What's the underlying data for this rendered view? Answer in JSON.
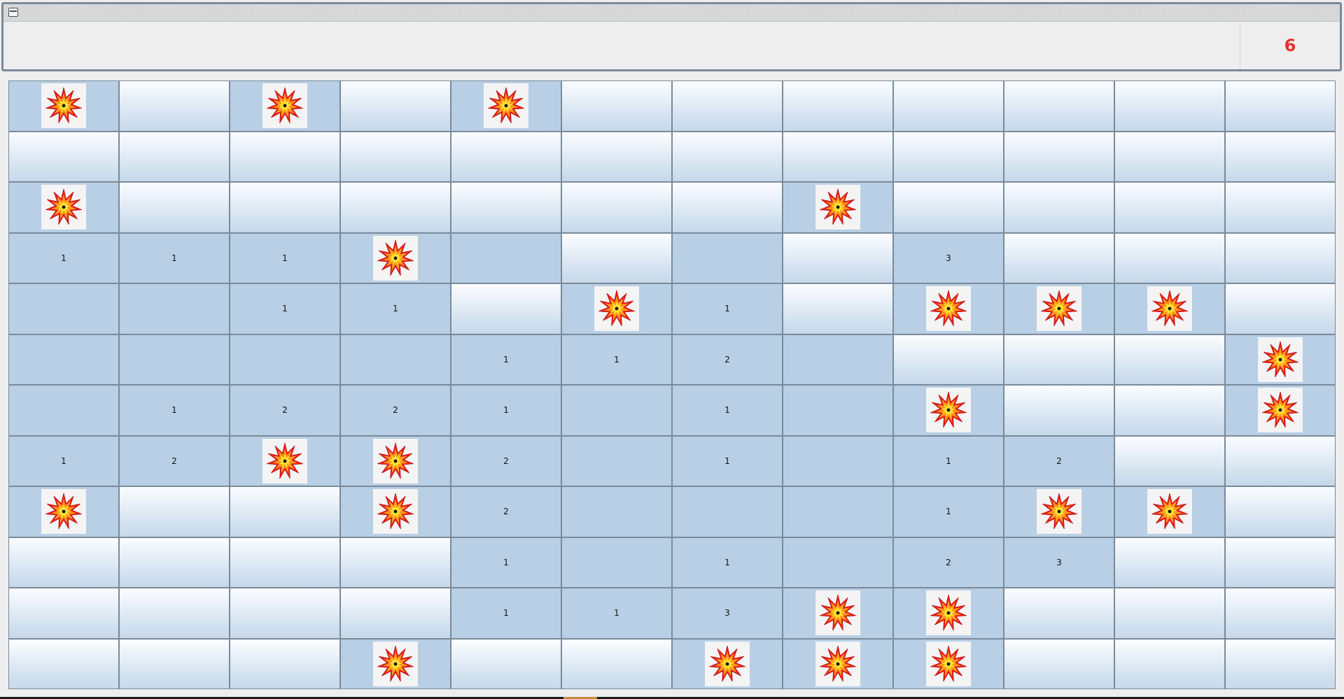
{
  "window": {
    "menu_icon": "window-menu-icon"
  },
  "counter": {
    "value": "6",
    "color": "#e8302e"
  },
  "board": {
    "rows": 12,
    "cols": 12,
    "mine_icon": "explosion-icon",
    "legend": {
      "M": "mine",
      "#": "covered",
      "0": "revealed-empty",
      "1-8": "revealed-number"
    },
    "grid": [
      "M#M#M#######",
      "############",
      "M######M####",
      "111M0#0#3###",
      "0011#M1#MMM#",
      "00001120###M",
      "01221010M##M",
      "12MM201012##",
      "M##M20001MM#",
      "####101023##",
      "####113MM###",
      "###M##MMM###"
    ]
  }
}
